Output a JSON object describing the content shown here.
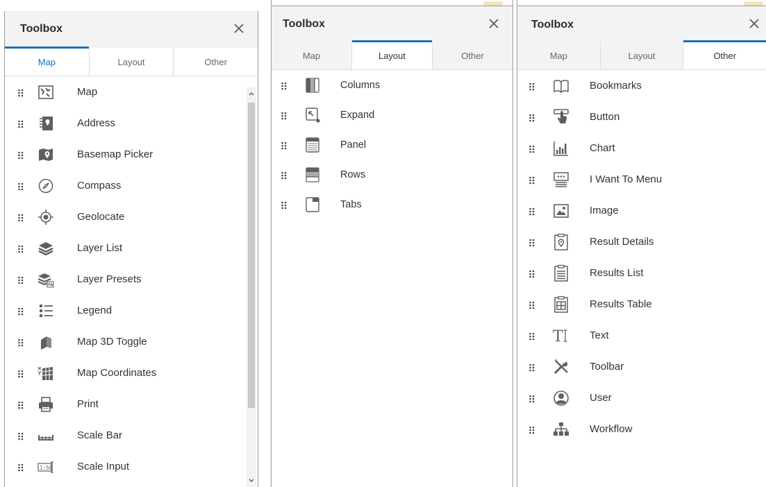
{
  "panels": [
    {
      "title": "Toolbox",
      "tabs": [
        "Map",
        "Layout",
        "Other"
      ],
      "active_tab": "Map",
      "items": [
        {
          "label": "Map",
          "icon": "map-icon"
        },
        {
          "label": "Address",
          "icon": "address-icon"
        },
        {
          "label": "Basemap Picker",
          "icon": "basemap-picker-icon"
        },
        {
          "label": "Compass",
          "icon": "compass-icon"
        },
        {
          "label": "Geolocate",
          "icon": "geolocate-icon"
        },
        {
          "label": "Layer List",
          "icon": "layer-list-icon"
        },
        {
          "label": "Layer Presets",
          "icon": "layer-presets-icon"
        },
        {
          "label": "Legend",
          "icon": "legend-icon"
        },
        {
          "label": "Map 3D Toggle",
          "icon": "map-3d-toggle-icon"
        },
        {
          "label": "Map Coordinates",
          "icon": "map-coordinates-icon"
        },
        {
          "label": "Print",
          "icon": "print-icon"
        },
        {
          "label": "Scale Bar",
          "icon": "scale-bar-icon"
        },
        {
          "label": "Scale Input",
          "icon": "scale-input-icon"
        }
      ]
    },
    {
      "title": "Toolbox",
      "tabs": [
        "Map",
        "Layout",
        "Other"
      ],
      "active_tab": "Layout",
      "items": [
        {
          "label": "Columns",
          "icon": "columns-icon"
        },
        {
          "label": "Expand",
          "icon": "expand-icon"
        },
        {
          "label": "Panel",
          "icon": "panel-icon"
        },
        {
          "label": "Rows",
          "icon": "rows-icon"
        },
        {
          "label": "Tabs",
          "icon": "tabs-icon"
        }
      ]
    },
    {
      "title": "Toolbox",
      "tabs": [
        "Map",
        "Layout",
        "Other"
      ],
      "active_tab": "Other",
      "items": [
        {
          "label": "Bookmarks",
          "icon": "bookmarks-icon"
        },
        {
          "label": "Button",
          "icon": "button-icon"
        },
        {
          "label": "Chart",
          "icon": "chart-icon"
        },
        {
          "label": "I Want To Menu",
          "icon": "i-want-to-menu-icon"
        },
        {
          "label": "Image",
          "icon": "image-icon"
        },
        {
          "label": "Result Details",
          "icon": "result-details-icon"
        },
        {
          "label": "Results List",
          "icon": "results-list-icon"
        },
        {
          "label": "Results Table",
          "icon": "results-table-icon"
        },
        {
          "label": "Text",
          "icon": "text-icon"
        },
        {
          "label": "Toolbar",
          "icon": "toolbar-icon"
        },
        {
          "label": "User",
          "icon": "user-icon"
        },
        {
          "label": "Workflow",
          "icon": "workflow-icon"
        }
      ]
    }
  ],
  "colors": {
    "accent": "#1f6fb5",
    "icon": "#5f5f5f",
    "header_bg": "#f3f3f3"
  }
}
